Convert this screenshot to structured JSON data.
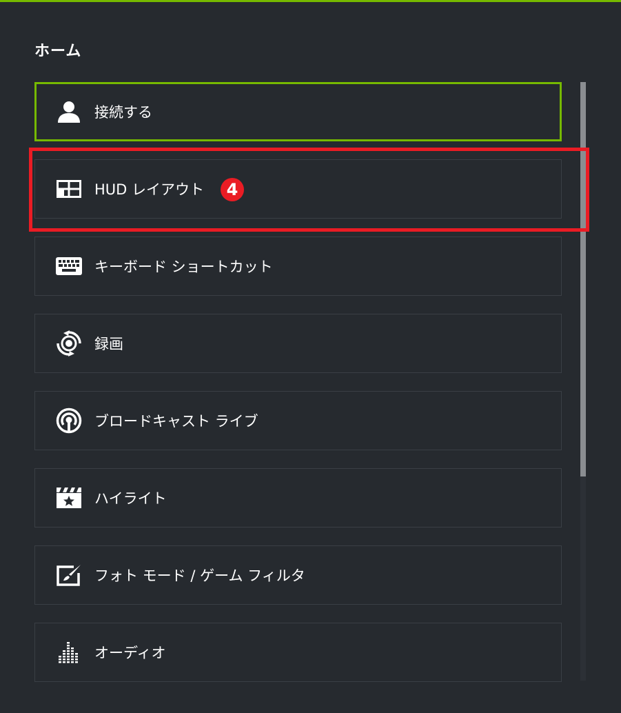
{
  "page": {
    "title": "ホーム"
  },
  "menu": {
    "items": [
      {
        "label": "接続する",
        "icon": "user-icon"
      },
      {
        "label": "HUD レイアウト",
        "icon": "layout-grid-icon"
      },
      {
        "label": "キーボード ショートカット",
        "icon": "keyboard-icon"
      },
      {
        "label": "録画",
        "icon": "record-icon"
      },
      {
        "label": "ブロードキャスト ライブ",
        "icon": "broadcast-icon"
      },
      {
        "label": "ハイライト",
        "icon": "clapperboard-star-icon"
      },
      {
        "label": "フォト モード / ゲーム フィルタ",
        "icon": "photo-edit-icon"
      },
      {
        "label": "オーディオ",
        "icon": "audio-equalizer-icon"
      }
    ],
    "selected_index": 0
  },
  "annotation": {
    "step_label": "4"
  },
  "colors": {
    "background": "#262a2f",
    "accent": "#76b900",
    "highlight": "#ea1c24",
    "item_border": "#3a3f45",
    "scroll_thumb": "#8a8d91"
  }
}
